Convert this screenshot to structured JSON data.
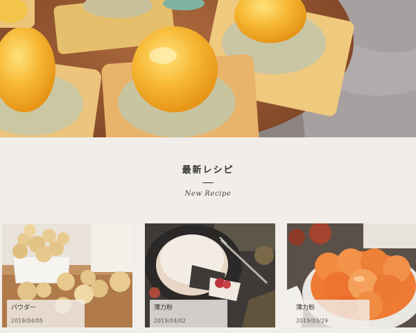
{
  "section": {
    "title": "最新レシピ",
    "subtitle": "New Recipe"
  },
  "recipes": [
    {
      "title": "パウダー",
      "date": "2019/04/05"
    },
    {
      "title": "薄力粉",
      "date": "2019/04/02"
    },
    {
      "title": "薄力粉",
      "date": "2019/03/29"
    }
  ],
  "colors": {
    "page_background": "#f1eeea",
    "text": "#333333",
    "card_label_background": "#f2eeea"
  }
}
